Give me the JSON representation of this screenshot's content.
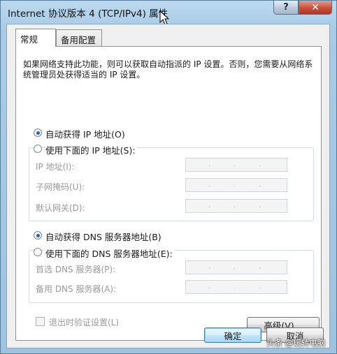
{
  "window": {
    "title": "Internet 协议版本 4 (TCP/IPv4) 属性",
    "help_label": "?",
    "close_label": "✕"
  },
  "tabs": [
    {
      "label": "常规"
    },
    {
      "label": "备用配置"
    }
  ],
  "general": {
    "description": "如果网络支持此功能，则可以获取自动指派的 IP 设置。否则，您需要从网络系统管理员处获得适当的 IP 设置。",
    "ip_auto_label": "自动获得 IP 地址(O)",
    "ip_manual_label": "使用下面的 IP 地址(S):",
    "ip_address_label": "IP 地址(I):",
    "subnet_label": "子网掩码(U):",
    "gateway_label": "默认网关(D):",
    "dns_auto_label": "自动获得 DNS 服务器地址(B)",
    "dns_manual_label": "使用下面的 DNS 服务器地址(E):",
    "dns_preferred_label": "首选 DNS 服务器(P):",
    "dns_alternate_label": "备用 DNS 服务器(A):",
    "validate_label": "退出时验证设置(L)",
    "advanced_label": "高级(V)...",
    "ip_auto_selected": true,
    "dns_auto_selected": true,
    "validate_checked": false
  },
  "footer": {
    "ok_label": "确定",
    "cancel_label": "取消"
  },
  "watermark": "头条 @玩转电脑",
  "icons": {
    "help": "help-icon",
    "close": "close-icon",
    "cursor": "cursor-icon"
  }
}
